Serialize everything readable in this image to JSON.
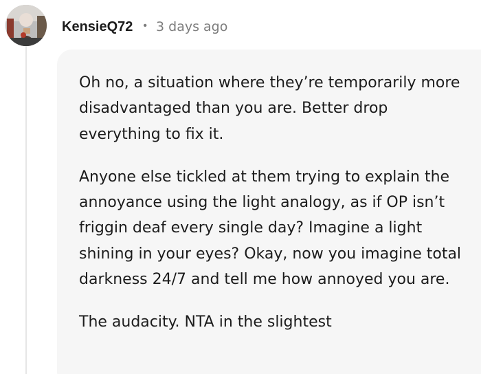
{
  "comment": {
    "author": "KensieQ72",
    "separator": "•",
    "timestamp": "3 days ago",
    "paragraphs": [
      "Oh no, a situation where they’re temporarily more disadvantaged than you are. Better drop everything to fix it.",
      "Anyone else tickled at them trying to explain the annoyance using the light analogy, as if OP isn’t friggin deaf every single day? Imagine a light shining in your eyes? Okay, now you imagine total darkness 24/7 and tell me how annoyed you are.",
      "The audacity. NTA in the slightest"
    ]
  },
  "colors": {
    "text": "#1c1c1c",
    "meta": "#7c7c7c",
    "bubble": "#f6f6f6",
    "thread_line": "#e6e6e6"
  }
}
